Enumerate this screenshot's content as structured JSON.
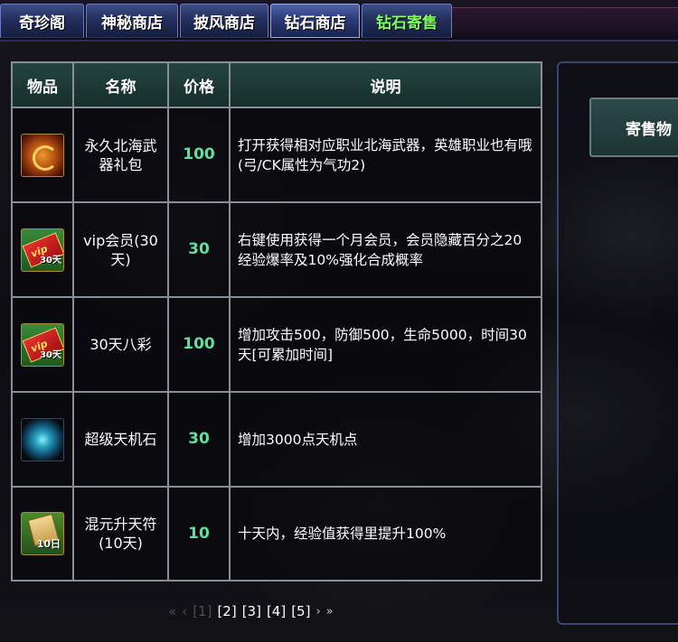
{
  "tabs": [
    {
      "label": "奇珍阁"
    },
    {
      "label": "神秘商店"
    },
    {
      "label": "披风商店"
    },
    {
      "label": "钻石商店"
    },
    {
      "label": "钻石寄售"
    }
  ],
  "table": {
    "headers": {
      "item": "物品",
      "name": "名称",
      "price": "价格",
      "desc": "说明"
    },
    "rows": [
      {
        "icon": "golden-dragon-emblem-icon",
        "name": "永久北海武器礼包",
        "price": "100",
        "desc": "打开获得相对应职业北海武器，英雄职业也有哦(弓/CK属性为气功2)"
      },
      {
        "icon": "vip-ticket-icon",
        "name": "vip会员(30天)",
        "price": "30",
        "desc": "右键使用获得一个月会员，会员隐藏百分之20经验爆率及10%强化合成概率"
      },
      {
        "icon": "vip-ticket-icon",
        "name": "30天八彩",
        "price": "100",
        "desc": "增加攻击500，防御500，生命5000，时间30天[可累加时间]"
      },
      {
        "icon": "glowing-orb-icon",
        "name": "超级天机石",
        "price": "30",
        "desc": "增加3000点天机点"
      },
      {
        "icon": "talisman-scroll-icon",
        "name": "混元升天符(10天)",
        "price": "10",
        "desc": "十天内，经验值获得里提升100%"
      }
    ],
    "icon_texts": {
      "vip": "vip",
      "days30": "30天",
      "days10": "10日"
    }
  },
  "pagination": {
    "first": "«",
    "prev": "‹",
    "pages": [
      "[1]",
      "[2]",
      "[3]",
      "[4]",
      "[5]"
    ],
    "current_page": 1,
    "next": "›",
    "last": "»"
  },
  "right_panel": {
    "button_label": "寄售物"
  },
  "colors": {
    "price": "#5fe0a0",
    "tab_highlight": "#7cff5a",
    "header_bg": "#24433f"
  }
}
